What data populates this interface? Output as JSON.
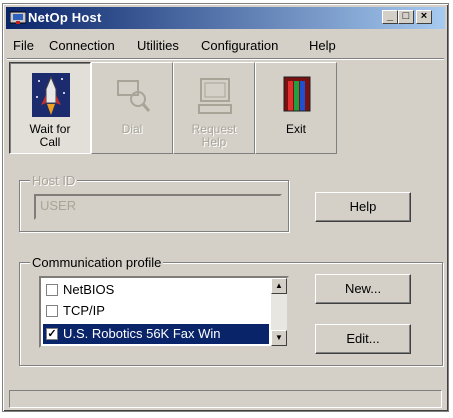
{
  "window": {
    "title": "NetOp Host",
    "controls": {
      "minimize": "_",
      "maximize": "□",
      "close": "×"
    }
  },
  "menu": [
    "File",
    "Connection",
    "Utilities",
    "Configuration",
    "Help"
  ],
  "toolbar": {
    "buttons": [
      {
        "label_line1": "Wait for",
        "label_line2": "Call",
        "icon": "rocket-icon",
        "state": "pressed"
      },
      {
        "label_line1": "Dial",
        "label_line2": "",
        "icon": "magnifier-icon",
        "state": "disabled"
      },
      {
        "label_line1": "Request",
        "label_line2": "Help",
        "icon": "computer-help-icon",
        "state": "disabled"
      },
      {
        "label_line1": "Exit",
        "label_line2": "",
        "icon": "exit-door-icon",
        "state": "enabled"
      }
    ]
  },
  "host_id": {
    "title": "Host ID",
    "value": "USER",
    "help_button": "Help"
  },
  "communication_profile": {
    "title": "Communication profile",
    "items": [
      {
        "label": "NetBIOS",
        "checked": false,
        "selected": false
      },
      {
        "label": "TCP/IP",
        "checked": false,
        "selected": false
      },
      {
        "label": "U.S. Robotics 56K Fax Win",
        "checked": true,
        "selected": true
      }
    ],
    "new_button": "New...",
    "edit_button": "Edit..."
  },
  "status": {
    "text": ""
  },
  "colors": {
    "titlebar": "#0a246a",
    "face": "#d4d0c8",
    "selection": "#0a246a"
  }
}
